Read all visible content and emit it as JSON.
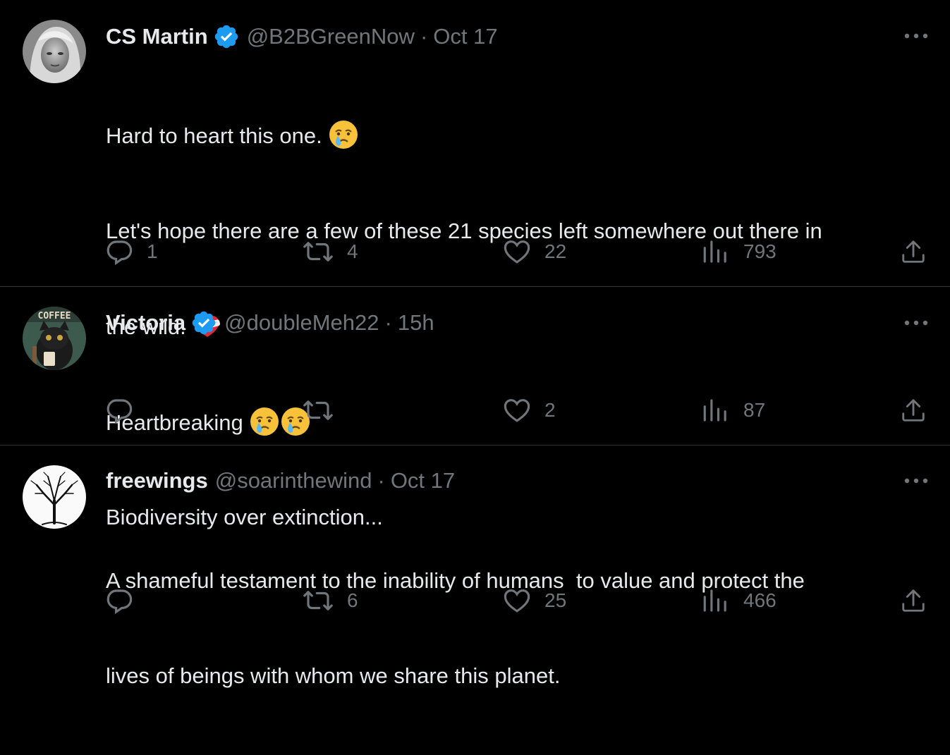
{
  "tweets": [
    {
      "name": "CS Martin",
      "verified": true,
      "handle": "@B2BGreenNow",
      "separator": "·",
      "time": "Oct 17",
      "lines": [
        "Hard to heart this one.",
        "Let's hope there are a few of these 21 species left somewhere out there in",
        "the wild.",
        "Biodiversity over extinction..."
      ],
      "emojis": [
        "crying-face",
        "mending-heart"
      ],
      "replies": "1",
      "retweets": "4",
      "likes": "22",
      "views": "793"
    },
    {
      "name": "Victoria",
      "verified": true,
      "handle": "@doubleMeh22",
      "separator": "·",
      "time": "15h",
      "avatar_text": "COFFEE",
      "lines": [
        "Heartbreaking"
      ],
      "emojis": [
        "crying-face",
        "crying-face"
      ],
      "replies": "",
      "retweets": "",
      "likes": "2",
      "views": "87"
    },
    {
      "name": "freewings",
      "verified": false,
      "handle": "@soarinthewind",
      "separator": "·",
      "time": "Oct 17",
      "lines": [
        "A shameful testament to the inability of humans  to value and protect the",
        "lives of beings with whom we share this planet."
      ],
      "replies": "",
      "retweets": "6",
      "likes": "25",
      "views": "466"
    }
  ],
  "colors": {
    "background": "#000000",
    "text": "#e7e9ea",
    "muted": "#71767b",
    "divider": "#2f3336",
    "verified": "#1d9bf0"
  }
}
